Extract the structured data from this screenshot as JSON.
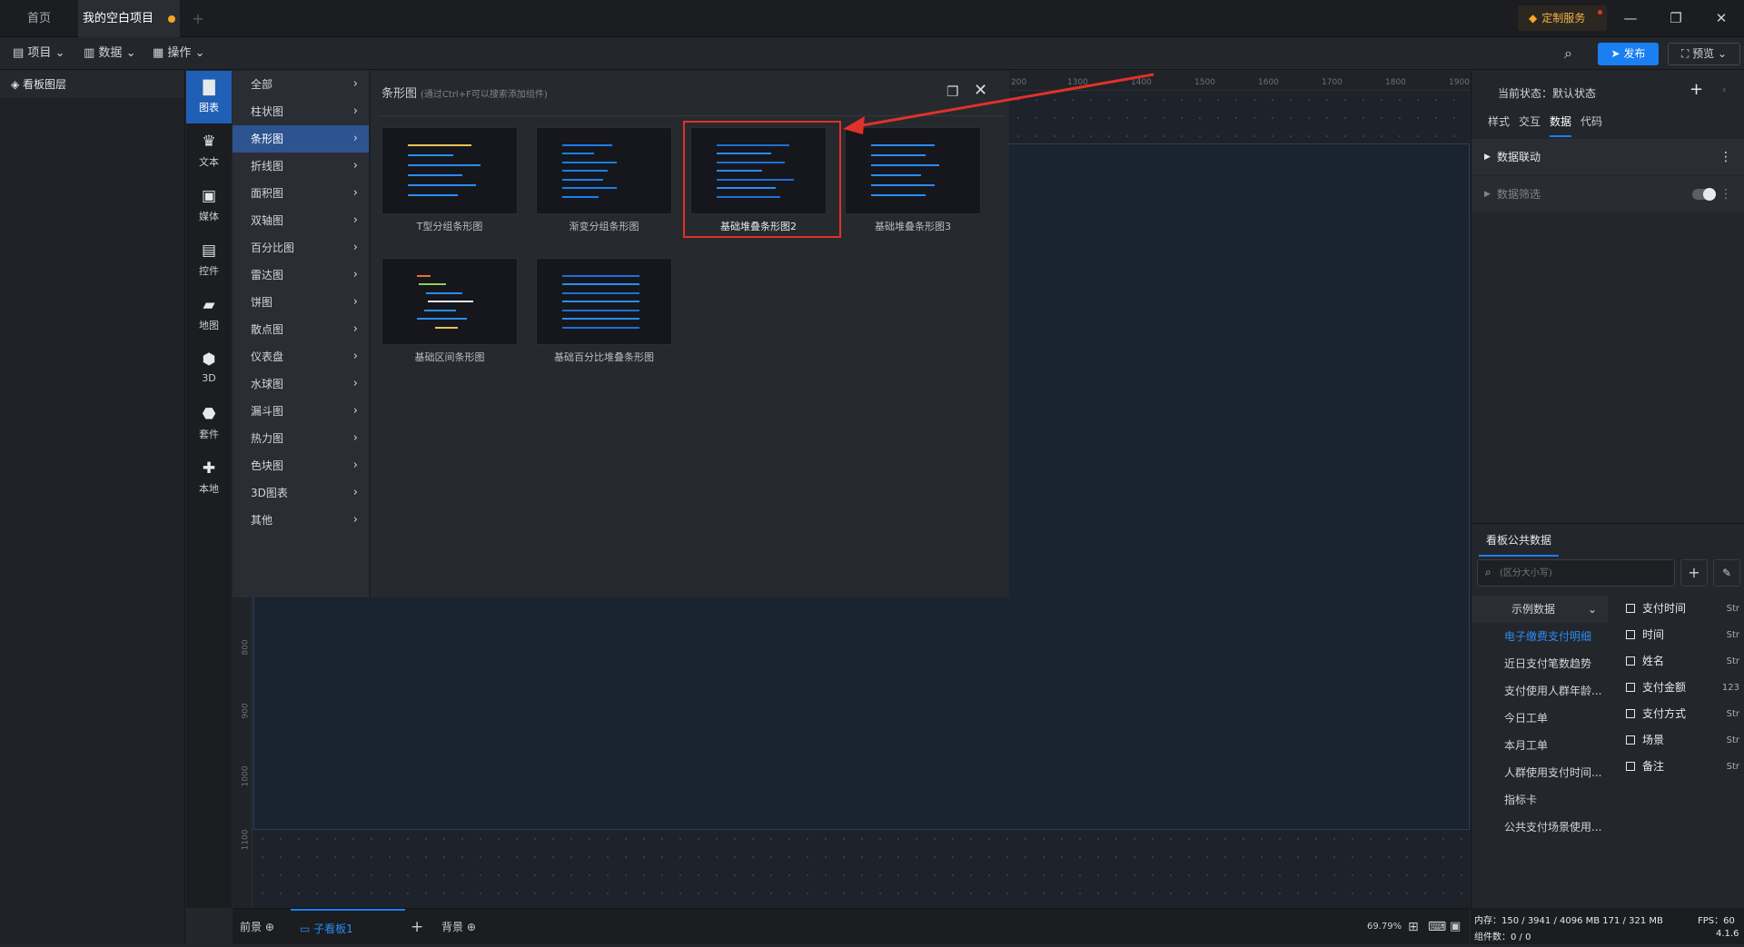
{
  "tabs": [
    {
      "label": "首页"
    },
    {
      "label": "我的空白项目"
    }
  ],
  "titlebar": {
    "custom_service": "定制服务",
    "new_tab": "+"
  },
  "toolbar": {
    "project": "项目",
    "data": "数据",
    "operate": "操作",
    "publish": "发布",
    "preview": "预览"
  },
  "layers": {
    "title": "看板图层"
  },
  "iconbar": [
    {
      "label": "图表",
      "icon": "bar-chart-icon"
    },
    {
      "label": "文本",
      "icon": "text-icon"
    },
    {
      "label": "媒体",
      "icon": "media-icon"
    },
    {
      "label": "控件",
      "icon": "control-icon"
    },
    {
      "label": "地图",
      "icon": "map-icon"
    },
    {
      "label": "3D",
      "icon": "cube-icon"
    },
    {
      "label": "套件",
      "icon": "kit-icon"
    },
    {
      "label": "本地",
      "icon": "puzzle-icon"
    }
  ],
  "categories": [
    "全部",
    "柱状图",
    "条形图",
    "折线图",
    "面积图",
    "双轴图",
    "百分比图",
    "雷达图",
    "饼图",
    "散点图",
    "仪表盘",
    "水球图",
    "漏斗图",
    "热力图",
    "色块图",
    "3D图表",
    "其他"
  ],
  "gallery": {
    "title": "条形图",
    "hint": "(通过Ctrl+F可以搜索添加组件)",
    "items": [
      "T型分组条形图",
      "渐变分组条形图",
      "基础堆叠条形图2",
      "基础堆叠条形图3",
      "基础区间条形图",
      "基础百分比堆叠条形图"
    ]
  },
  "ruler": {
    "top": [
      "200",
      "1300",
      "1400",
      "1500",
      "1600",
      "1700",
      "1800",
      "1900"
    ],
    "left": [
      "800",
      "900",
      "1000",
      "1100"
    ]
  },
  "bottombar": {
    "front": "前景",
    "sub_board": "子看板1",
    "add": "+",
    "back": "背景",
    "zoom": "69.79%"
  },
  "rpanel": {
    "state_label": "当前状态：默认状态",
    "tabs": [
      "样式",
      "交互",
      "数据",
      "代码"
    ],
    "linkage": "数据联动",
    "filter": "数据筛选",
    "public_data": "看板公共数据",
    "search_placeholder": "(区分大小写)",
    "dataset_group": "示例数据",
    "datasets": [
      "电子缴费支付明细",
      "近日支付笔数趋势",
      "支付使用人群年龄...",
      "今日工单",
      "本月工单",
      "人群使用支付时间...",
      "指标卡",
      "公共支付场景使用..."
    ],
    "fields": [
      {
        "name": "支付时间",
        "type": "Str"
      },
      {
        "name": "时间",
        "type": "Str"
      },
      {
        "name": "姓名",
        "type": "Str"
      },
      {
        "name": "支付金额",
        "type": "123"
      },
      {
        "name": "支付方式",
        "type": "Str"
      },
      {
        "name": "场景",
        "type": "Str"
      },
      {
        "name": "备注",
        "type": "Str"
      }
    ]
  },
  "status": {
    "memory": "内存：150 / 3941 / 4096 MB  171 / 321 MB",
    "fps": "FPS：60",
    "components": "组件数：0 / 0",
    "version": "4.1.6"
  },
  "colors": {
    "accent": "#1a7ff0",
    "selected_border": "#e0312a",
    "annotation_arrow": "#e0312a"
  }
}
